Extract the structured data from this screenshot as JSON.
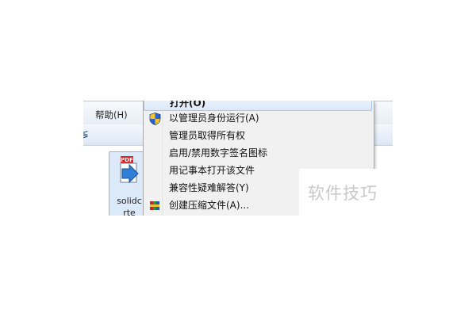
{
  "window": {
    "menubar": {
      "help_label": "帮助(H)"
    },
    "toolbar_glyph": "≶"
  },
  "file": {
    "badge": "PDF",
    "name_line1": "solidc",
    "name_line2": "rte"
  },
  "context_menu": {
    "items": [
      {
        "label": "打开(O)",
        "icon": "none",
        "default": true
      },
      {
        "label": "以管理员身份运行(A)",
        "icon": "uac-shield-icon"
      },
      {
        "label": "管理员取得所有权",
        "icon": "none"
      },
      {
        "label": "启用/禁用数字签名图标",
        "icon": "none"
      },
      {
        "label": "用记事本打开该文件",
        "icon": "none"
      },
      {
        "label": "兼容性疑难解答(Y)",
        "icon": "none"
      },
      {
        "label": "创建压缩文件(A)...",
        "icon": "winrar-archive-icon"
      }
    ]
  },
  "watermark": {
    "text": "软件技巧"
  },
  "colors": {
    "menu_bg": "#f1f1f1",
    "highlight_border": "#a8c8ec",
    "selection_bg": "#dce9f9",
    "watermark": "#c8c8c8"
  }
}
